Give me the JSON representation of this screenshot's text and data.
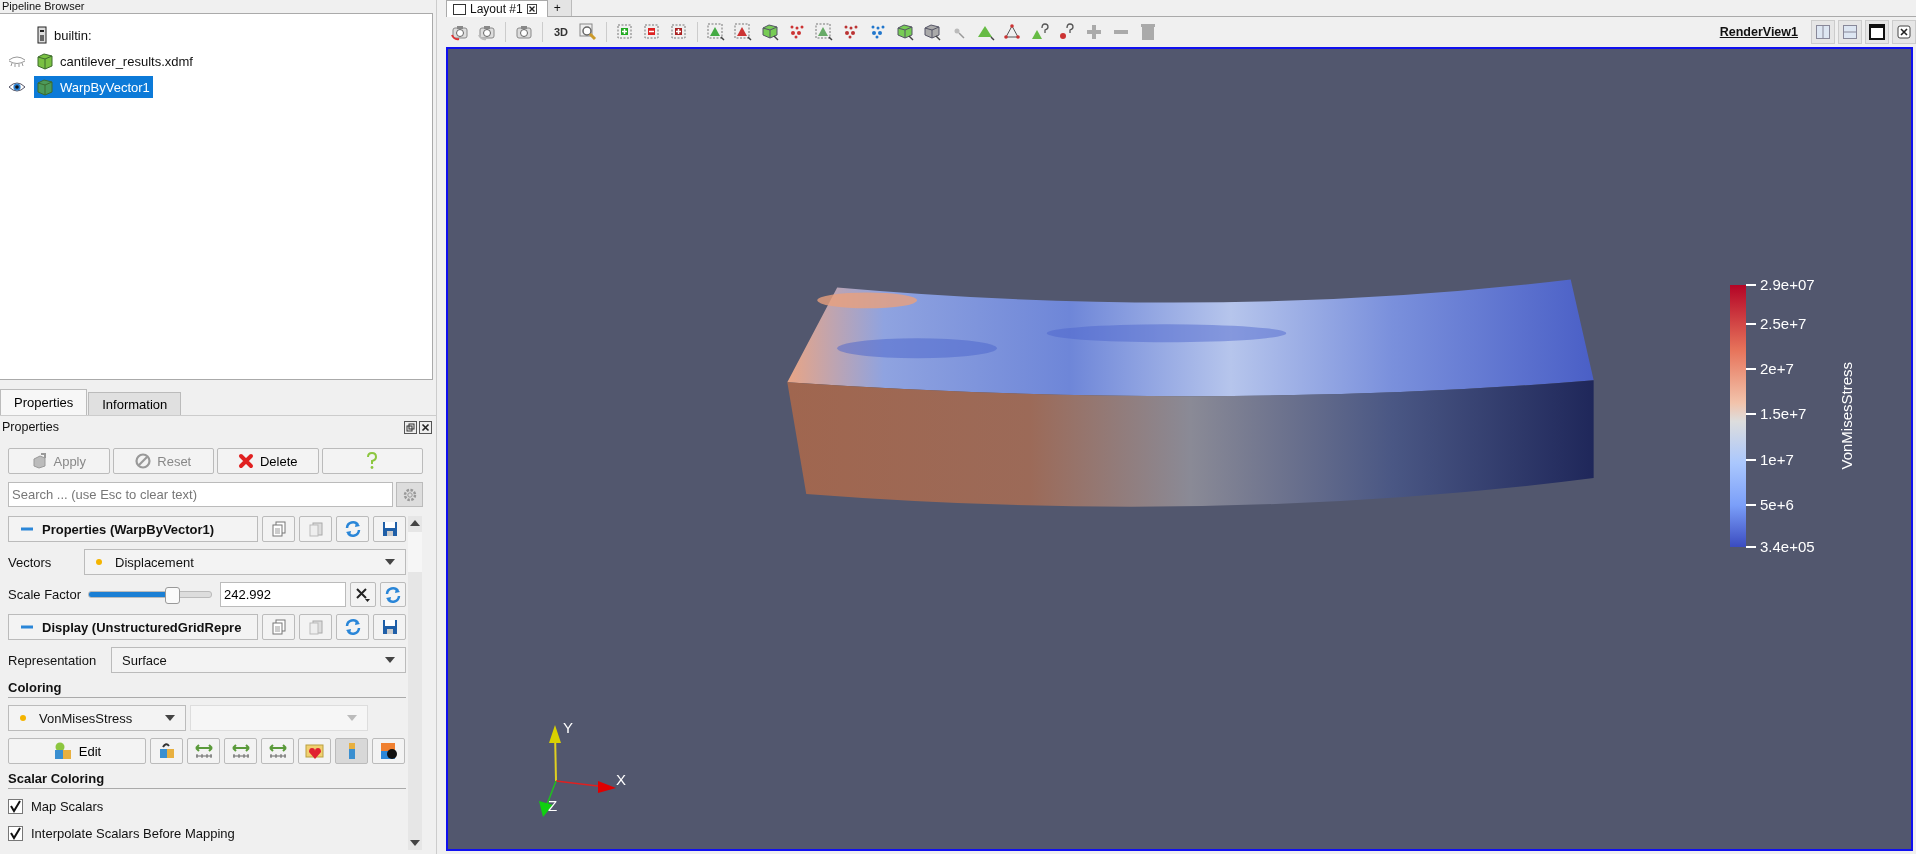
{
  "pipeline_browser": {
    "title": "Pipeline Browser",
    "items": [
      {
        "label": "builtin:",
        "kind": "server",
        "selected": false
      },
      {
        "label": "cantilever_results.xdmf",
        "kind": "source",
        "visible": false,
        "selected": false
      },
      {
        "label": "WarpByVector1",
        "kind": "filter",
        "visible": true,
        "selected": true
      }
    ]
  },
  "panel_tabs": [
    {
      "label": "Properties",
      "selected": true
    },
    {
      "label": "Information",
      "selected": false
    }
  ],
  "properties": {
    "title": "Properties",
    "buttons": [
      {
        "label": "Apply",
        "kind": "apply",
        "disabled": true
      },
      {
        "label": "Reset",
        "kind": "reset",
        "disabled": true
      },
      {
        "label": "Delete",
        "kind": "delete",
        "disabled": false
      }
    ],
    "search": {
      "placeholder": "Search ... (use Esc to clear text)"
    },
    "properties_section": {
      "title": "Properties (WarpByVector1)",
      "expanded": true
    },
    "vectors": {
      "label": "Vectors",
      "value": "Displacement"
    },
    "scale_factor": {
      "label": "Scale Factor",
      "level": 0.68,
      "value": "242.992"
    },
    "display_section": {
      "title": "Display (UnstructuredGridRepre",
      "expanded": true
    },
    "representation": {
      "label": "Representation",
      "value": "Surface"
    },
    "coloring": {
      "title": "Coloring",
      "array": "VonMisesStress",
      "edit": "Edit"
    },
    "scalar_coloring": {
      "title": "Scalar Coloring",
      "options": [
        {
          "label": "Map Scalars",
          "checked": true
        },
        {
          "label": "Interpolate Scalars Before Mapping",
          "checked": true
        }
      ]
    }
  },
  "layout_tabs": [
    {
      "label": "Layout #1",
      "selected": true
    },
    {
      "label": "+",
      "selected": false
    }
  ],
  "toolbar": {
    "view_mode": "3D"
  },
  "render_view": {
    "title": "RenderView1",
    "color_legend": {
      "title": "VonMisesStress",
      "labels": [
        "2.9e+07",
        "2.5e+7",
        "2e+7",
        "1.5e+7",
        "1e+7",
        "5e+6",
        "3.4e+05"
      ]
    },
    "axes": [
      "X",
      "Y",
      "Z"
    ]
  }
}
